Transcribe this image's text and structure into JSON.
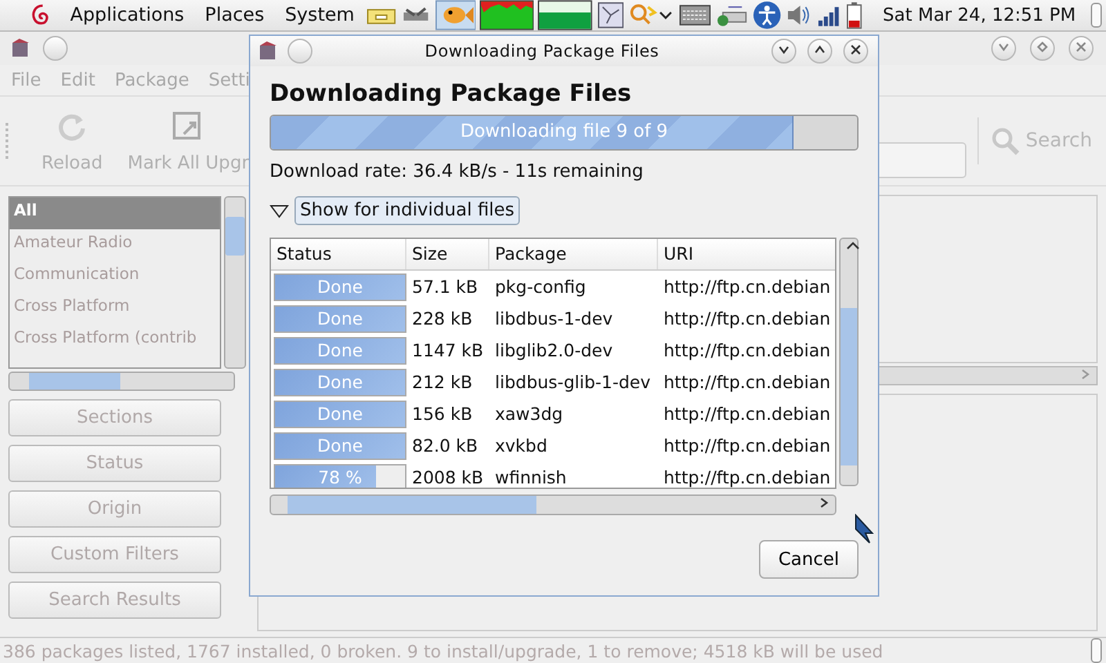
{
  "top_panel": {
    "menus": [
      "Applications",
      "Places",
      "System"
    ],
    "clock": "Sat Mar 24, 12:51 PM"
  },
  "main_window": {
    "menu": [
      "File",
      "Edit",
      "Package",
      "Setti"
    ],
    "toolbar": [
      "Reload",
      "Mark All Upgr"
    ],
    "search_label": "Search",
    "filter_list": [
      {
        "label": "All",
        "selected": true
      },
      {
        "label": "Amateur Radio",
        "selected": false
      },
      {
        "label": "Communication",
        "selected": false
      },
      {
        "label": "Cross Platform",
        "selected": false
      },
      {
        "label": "Cross Platform (contrib",
        "selected": false
      }
    ],
    "filter_buttons": [
      "Sections",
      "Status",
      "Origin",
      "Custom Filters",
      "Search Results"
    ],
    "status_bar": "386 packages listed, 1767 installed, 0 broken. 9 to install/upgrade, 1 to remove; 4518 kB will be used"
  },
  "dialog": {
    "title": "Downloading Package Files",
    "heading": "Downloading Package Files",
    "progress": {
      "level": 0.89,
      "text": "Downloading file 9 of 9"
    },
    "rate": "Download rate: 36.4 kB/s - 11s remaining",
    "expander": {
      "label": "Show for individual files",
      "expanded": true
    },
    "columns": [
      "Status",
      "Size",
      "Package",
      "URI"
    ],
    "rows": [
      {
        "status": "Done",
        "level": 1,
        "size": "57.1 kB",
        "package": "pkg-config",
        "uri": "http://ftp.cn.debian"
      },
      {
        "status": "Done",
        "level": 1,
        "size": "228 kB",
        "package": "libdbus-1-dev",
        "uri": "http://ftp.cn.debian"
      },
      {
        "status": "Done",
        "level": 1,
        "size": "1147 kB",
        "package": "libglib2.0-dev",
        "uri": "http://ftp.cn.debian"
      },
      {
        "status": "Done",
        "level": 1,
        "size": "212 kB",
        "package": "libdbus-glib-1-dev",
        "uri": "http://ftp.cn.debian"
      },
      {
        "status": "Done",
        "level": 1,
        "size": "156 kB",
        "package": "xaw3dg",
        "uri": "http://ftp.cn.debian"
      },
      {
        "status": "Done",
        "level": 1,
        "size": "82.0 kB",
        "package": "xvkbd",
        "uri": "http://ftp.cn.debian"
      },
      {
        "status": "78 %",
        "level": 0.78,
        "size": "2008 kB",
        "package": "wfinnish",
        "uri": "http://ftp.cn.debian"
      }
    ],
    "cancel": "Cancel"
  }
}
